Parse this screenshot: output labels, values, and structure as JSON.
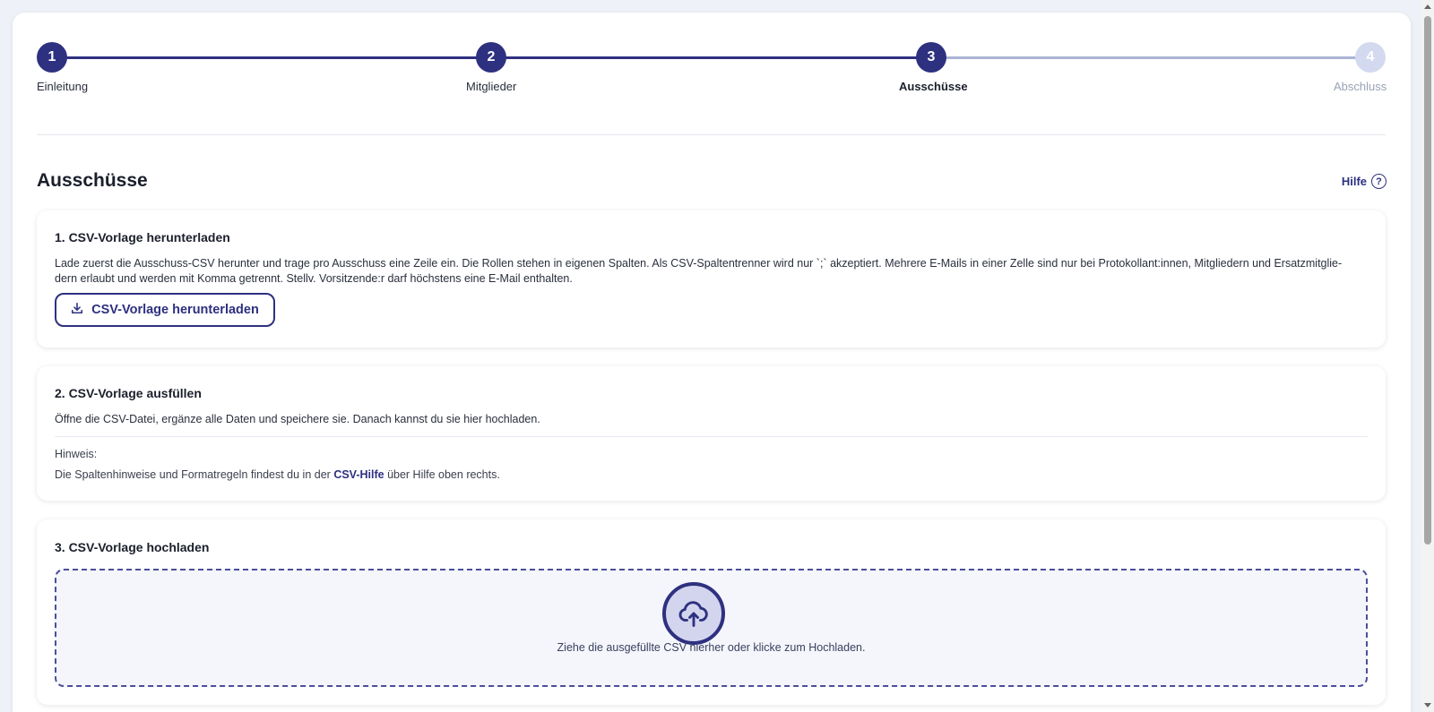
{
  "stepper": {
    "steps": [
      {
        "number": "1",
        "label": "Einleitung"
      },
      {
        "number": "2",
        "label": "Mitglieder"
      },
      {
        "number": "3",
        "label": "Ausschüsse"
      },
      {
        "number": "4",
        "label": "Abschluss"
      }
    ],
    "current_step": 3,
    "colors": {
      "active": "#2e3080",
      "inactive": "#d3daf0"
    }
  },
  "page": {
    "title": "Ausschüsse",
    "help_label": "Hilfe",
    "help_icon": "question-circle-icon"
  },
  "section1": {
    "title": "1. CSV-Vorlage herunterladen",
    "text_line1": "Lade zuerst die Ausschuss-CSV herunter und trage pro Ausschuss eine Zeile ein. Die Rollen stehen in eigenen Spalten. Als CSV-Spaltentrenner wird nur `;` akzeptiert. Mehrere E-Mails in einer Zelle sind nur bei Protokollant:innen, Mitgliedern und Ersatzmitglie-",
    "text_line2": "dern erlaubt und werden mit Komma getrennt. Stellv. Vorsitzende:r darf höchstens eine E-Mail enthalten.",
    "button_label": "CSV-Vorlage herunterladen",
    "button_icon": "download-icon"
  },
  "section2": {
    "title": "2. CSV-Vorlage ausfüllen",
    "text": "Öffne die CSV-Datei, ergänze alle Daten und speichere sie. Danach kannst du sie hier hochladen.",
    "note_label": "Hinweis:",
    "note_prefix": "Die Spaltenhinweise und Formatregeln findest du in der",
    "note_link": "CSV-Hilfe",
    "note_suffix": "über Hilfe oben rechts."
  },
  "section3": {
    "title": "3. CSV-Vorlage hochladen",
    "dropzone_text": "Ziehe die ausgefüllte CSV hierher oder klicke zum Hochladen.",
    "dropzone_icon": "cloud-upload-icon"
  }
}
